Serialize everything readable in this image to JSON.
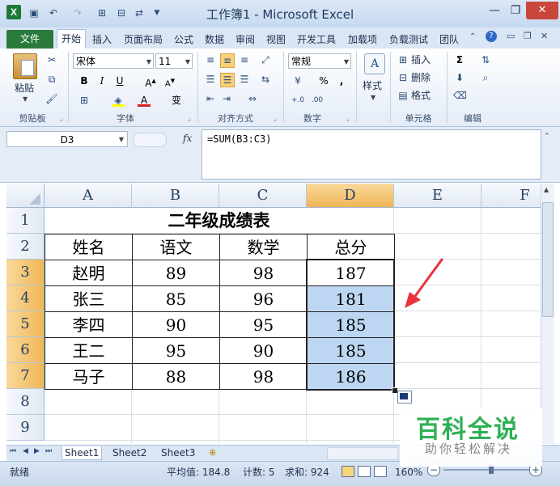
{
  "window": {
    "title": "工作簿1 - Microsoft Excel"
  },
  "tabs": [
    "文件",
    "开始",
    "插入",
    "页面布局",
    "公式",
    "数据",
    "审阅",
    "视图",
    "开发工具",
    "加载项",
    "负载测试",
    "团队"
  ],
  "ribbon": {
    "paste_label": "粘贴",
    "font_name": "宋体",
    "font_size": "11",
    "number_format": "常规",
    "style_label": "样式",
    "insert_label": "插入",
    "delete_label": "删除",
    "format_label": "格式",
    "bold": "B",
    "italic": "I",
    "underline": "U",
    "percent": "%",
    "comma": ",",
    "wen": "变",
    "sigma": "Σ",
    "groups": [
      "剪贴板",
      "字体",
      "对齐方式",
      "数字",
      "单元格",
      "编辑"
    ]
  },
  "formula_bar": {
    "name_box": "D3",
    "fx": "fx",
    "formula": "=SUM(B3:C3)"
  },
  "sheet": {
    "columns": [
      "A",
      "B",
      "C",
      "D",
      "E",
      "F"
    ],
    "rows": [
      "1",
      "2",
      "3",
      "4",
      "5",
      "6",
      "7",
      "8",
      "9"
    ],
    "title": "二年级成绩表",
    "headers": [
      "姓名",
      "语文",
      "数学",
      "总分"
    ],
    "data": [
      [
        "赵明",
        "89",
        "98",
        "187"
      ],
      [
        "张三",
        "85",
        "96",
        "181"
      ],
      [
        "李四",
        "90",
        "95",
        "185"
      ],
      [
        "王二",
        "95",
        "90",
        "185"
      ],
      [
        "马子",
        "88",
        "98",
        "186"
      ]
    ]
  },
  "sheet_tabs": [
    "Sheet1",
    "Sheet2",
    "Sheet3"
  ],
  "status": {
    "ready": "就绪",
    "average": "平均值: 184.8",
    "count": "计数: 5",
    "sum": "求和: 924",
    "zoom": "160%"
  },
  "watermark": {
    "line1": "百科全说",
    "line2": "助你轻松解决"
  },
  "colors": {
    "highlight": "#bdd7f2",
    "selected_header": "#f0b656",
    "file_tab": "#2a7a3c",
    "arrow": "#e8323c"
  }
}
